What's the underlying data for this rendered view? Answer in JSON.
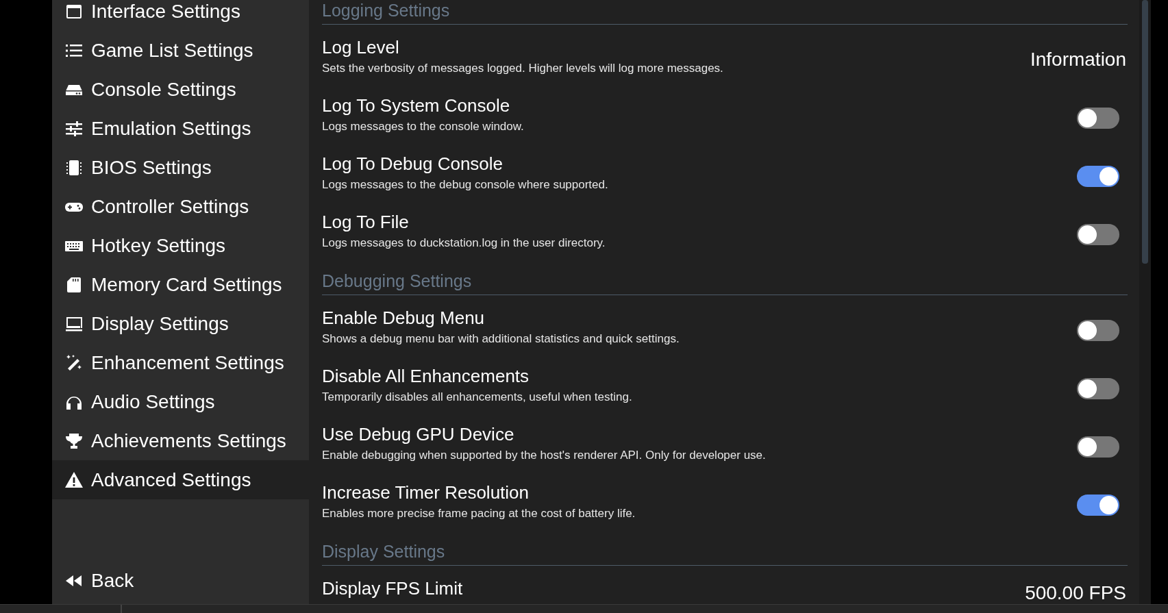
{
  "sidebar": {
    "items": [
      {
        "label": "Interface Settings",
        "selected": false
      },
      {
        "label": "Game List Settings",
        "selected": false
      },
      {
        "label": "Console Settings",
        "selected": false
      },
      {
        "label": "Emulation Settings",
        "selected": false
      },
      {
        "label": "BIOS Settings",
        "selected": false
      },
      {
        "label": "Controller Settings",
        "selected": false
      },
      {
        "label": "Hotkey Settings",
        "selected": false
      },
      {
        "label": "Memory Card Settings",
        "selected": false
      },
      {
        "label": "Display Settings",
        "selected": false
      },
      {
        "label": "Enhancement Settings",
        "selected": false
      },
      {
        "label": "Audio Settings",
        "selected": false
      },
      {
        "label": "Achievements Settings",
        "selected": false
      },
      {
        "label": "Advanced Settings",
        "selected": true
      }
    ],
    "back_button": {
      "label": "Back"
    }
  },
  "sections": [
    {
      "title": "Logging Settings",
      "settings": [
        {
          "kind": "value",
          "title": "Log Level",
          "description": "Sets the verbosity of messages logged. Higher levels will log more messages.",
          "value": "Information"
        },
        {
          "kind": "toggle",
          "title": "Log To System Console",
          "description": "Logs messages to the console window.",
          "on": false
        },
        {
          "kind": "toggle",
          "title": "Log To Debug Console",
          "description": "Logs messages to the debug console where supported.",
          "on": true
        },
        {
          "kind": "toggle",
          "title": "Log To File",
          "description": "Logs messages to duckstation.log in the user directory.",
          "on": false
        }
      ]
    },
    {
      "title": "Debugging Settings",
      "settings": [
        {
          "kind": "toggle",
          "title": "Enable Debug Menu",
          "description": "Shows a debug menu bar with additional statistics and quick settings.",
          "on": false
        },
        {
          "kind": "toggle",
          "title": "Disable All Enhancements",
          "description": "Temporarily disables all enhancements, useful when testing.",
          "on": false
        },
        {
          "kind": "toggle",
          "title": "Use Debug GPU Device",
          "description": "Enable debugging when supported by the host's renderer API. Only for developer use.",
          "on": false
        },
        {
          "kind": "toggle",
          "title": "Increase Timer Resolution",
          "description": "Enables more precise frame pacing at the cost of battery life.",
          "on": true
        }
      ]
    },
    {
      "title": "Display Settings",
      "settings": [
        {
          "kind": "value",
          "title": "Display FPS Limit",
          "value": "500.00 FPS"
        }
      ]
    }
  ]
}
